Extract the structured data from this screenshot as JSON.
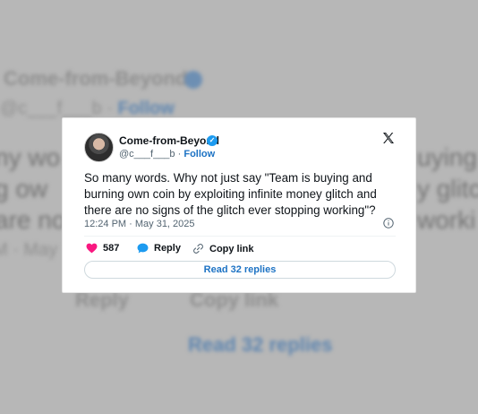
{
  "author": {
    "name": "Come-from-Beyond",
    "handle": "@c___f___b",
    "separator": "·",
    "follow_label": "Follow"
  },
  "tweet": {
    "text": "So many words. Why not just say \"Team is buying and burning own coin by exploiting infinite money glitch and there are no signs of the glitch ever stopping working\"?",
    "timestamp": "12:24 PM · May 31, 2025"
  },
  "actions": {
    "like_count": "587",
    "reply_label": "Reply",
    "copy_link_label": "Copy link",
    "read_replies_label": "Read 32 replies"
  },
  "background": {
    "name": "Come-from-Beyond",
    "handle": "@c___f___b · ",
    "follow": "Follow",
    "line1_left": "ny wo",
    "line2_left": "g ow",
    "line3_left": "are no",
    "line1_right": "uying a",
    "line2_right": "y glitc",
    "line3_right": "worki",
    "meta": "M · May",
    "reply": "Reply",
    "copy": "Copy link",
    "read": "Read 32 replies"
  },
  "colors": {
    "accent": "#1d9bf0",
    "like": "#f91880",
    "link": "#1d73c4"
  },
  "icons": [
    "verified-badge-icon",
    "x-logo-icon",
    "info-icon",
    "heart-icon",
    "reply-bubble-icon",
    "link-icon"
  ]
}
